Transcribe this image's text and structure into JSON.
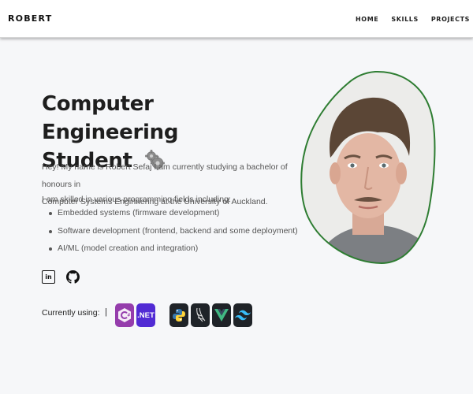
{
  "header": {
    "brand": "ROBERT",
    "nav": [
      "HOME",
      "SKILLS",
      "PROJECTS"
    ]
  },
  "hero": {
    "title_line1": "Computer Engineering",
    "title_line2": "Student",
    "intro_line1": "Hey! My name is Robert Sefaj I am currently studying a bachelor of honours in",
    "intro_line2": "Computer Systems Enginnering at the University of Auckland.",
    "skills_intro": "I am skilled in various programming fields including:",
    "skills": [
      "Embedded systems (firmware development)",
      "Software development (frontend, backend and some deployment)",
      "AI/ML (model creation and integration)"
    ],
    "currently_using_label": "Currently using:",
    "separator": "|",
    "dotnet_label": ".NET"
  },
  "colors": {
    "accent_border": "#2e7d32",
    "csharp": "#953dac",
    "dotnet": "#512bd4",
    "dark_tile": "#1f2328"
  },
  "icons": [
    "gears-icon",
    "linkedin-icon",
    "github-icon",
    "csharp-icon",
    "dotnet-icon",
    "python-icon",
    "flask-icon",
    "vue-icon",
    "tailwind-icon"
  ]
}
